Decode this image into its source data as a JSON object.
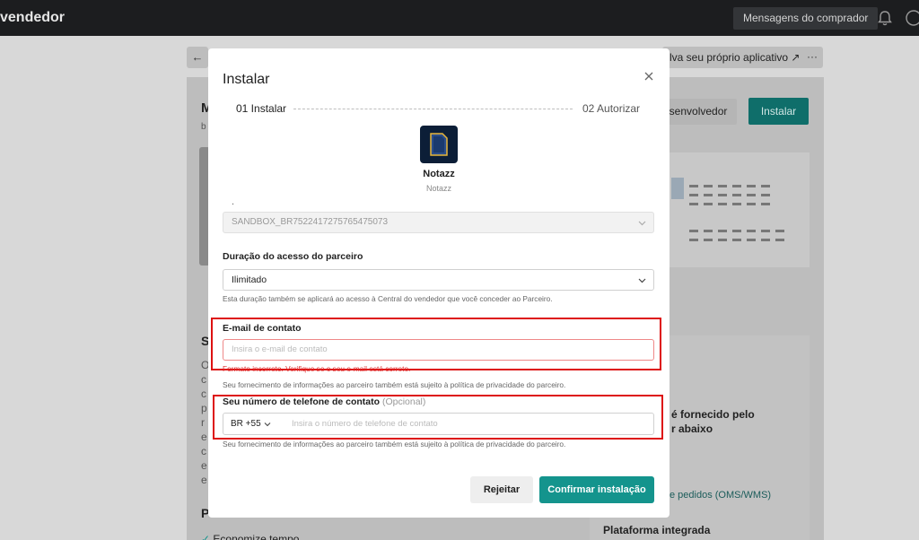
{
  "topbar": {
    "brand": "vendedor",
    "buyer_messages": "Mensagens do comprador",
    "icons": [
      "bell-icon",
      "user-icon"
    ]
  },
  "background": {
    "develop_link": "lva seu próprio aplicativo",
    "developer_button": "esenvolvedor",
    "install_button": "Instalar",
    "right_panel_line1": "é fornecido pelo",
    "right_panel_line2": "r abaixo",
    "oms_link": "e pedidos (OMS/WMS)",
    "platform": "Plataforma integrada",
    "economize": "Economize tempo",
    "left_letters": [
      "M",
      "b",
      "S",
      "O",
      "c",
      "c",
      "p",
      "r",
      "e",
      "c",
      "e",
      "e",
      "P"
    ]
  },
  "modal": {
    "title": "Instalar",
    "steps": {
      "step1": "01 Instalar",
      "step2": "02 Autorizar"
    },
    "app": {
      "name": "Notazz",
      "subtitle": "Notazz"
    },
    "field_dot": ".",
    "shop_select": "SANDBOX_BR7522417275765475073",
    "duration": {
      "label": "Duração do acesso do parceiro",
      "value": "Ilimitado",
      "help": "Esta duração também se aplicará ao acesso à Central do vendedor que você conceder ao Parceiro."
    },
    "email": {
      "label": "E-mail de contato",
      "placeholder": "Insira o e-mail de contato",
      "error": "Formato incorreto. Verifique se o seu e-mail está correto.",
      "help": "Seu fornecimento de informações ao parceiro também está sujeito à política de privacidade do parceiro."
    },
    "phone": {
      "label": "Seu número de telefone de contato",
      "optional": "(Opcional)",
      "country": "BR +55",
      "placeholder": "Insira o número de telefone de contato",
      "help": "Seu fornecimento de informações ao parceiro também está sujeito à política de privacidade do parceiro."
    },
    "buttons": {
      "reject": "Rejeitar",
      "confirm": "Confirmar instalação"
    }
  },
  "colors": {
    "accent": "#14948d",
    "error": "#e03030",
    "highlight": "#dd1111"
  }
}
